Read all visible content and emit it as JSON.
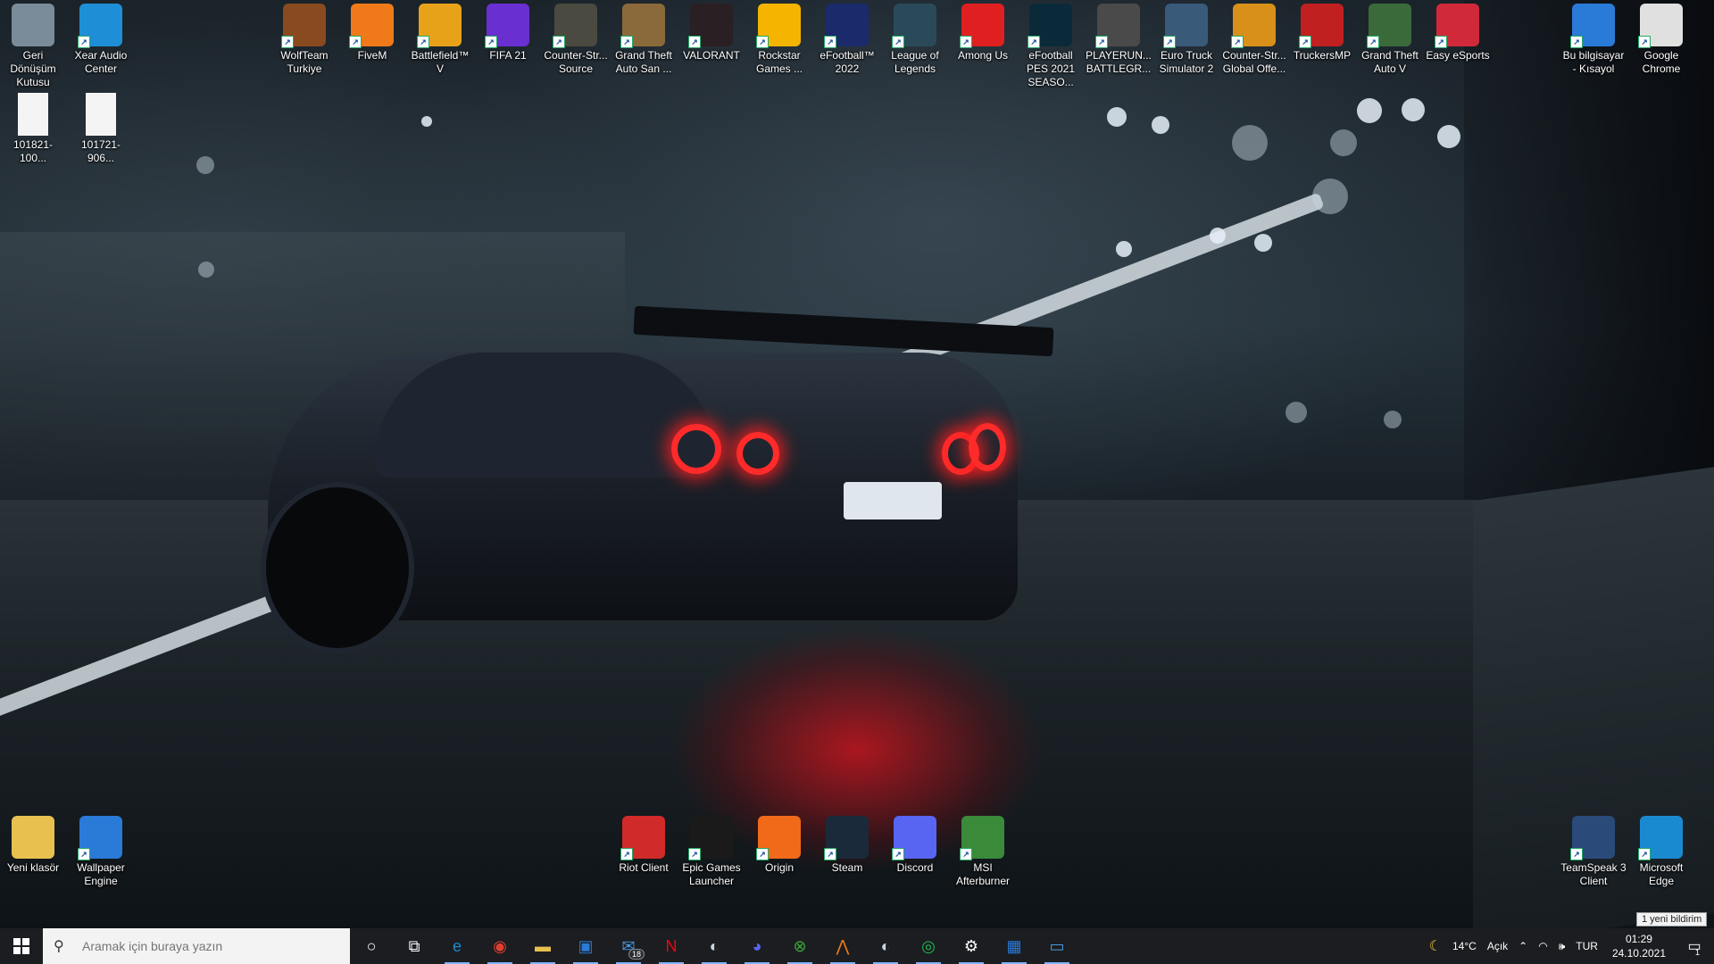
{
  "desktop": {
    "icons": [
      {
        "id": "recycle",
        "label": "Geri Dönüşüm Kutusu",
        "icon": "recycle-bin-icon",
        "color": "#7a8c99"
      },
      {
        "id": "xear",
        "label": "Xear Audio Center",
        "icon": "xear-audio-icon",
        "color": "#1e8fd6"
      },
      {
        "id": "wolfteam",
        "label": "WolfTeam Turkiye",
        "icon": "wolfteam-icon",
        "color": "#8a4a20"
      },
      {
        "id": "fivem",
        "label": "FiveM",
        "icon": "fivem-icon",
        "color": "#f07a1a"
      },
      {
        "id": "bf5",
        "label": "Battlefield™ V",
        "icon": "battlefield-icon",
        "color": "#e8a21a"
      },
      {
        "id": "fifa",
        "label": "FIFA 21",
        "icon": "fifa-icon",
        "color": "#6a2fd0"
      },
      {
        "id": "css",
        "label": "Counter-Str... Source",
        "icon": "cs-source-icon",
        "color": "#4a4a40"
      },
      {
        "id": "gtasa",
        "label": "Grand Theft Auto San ...",
        "icon": "gta-sa-icon",
        "color": "#8a6a3a"
      },
      {
        "id": "valorant",
        "label": "VALORANT",
        "icon": "valorant-icon",
        "color": "#2a1f22"
      },
      {
        "id": "rockstar",
        "label": "Rockstar Games ...",
        "icon": "rockstar-icon",
        "color": "#f4b400"
      },
      {
        "id": "efootball",
        "label": "eFootball™ 2022",
        "icon": "efootball-icon",
        "color": "#1a2a6a"
      },
      {
        "id": "lol",
        "label": "League of Legends",
        "icon": "lol-icon",
        "color": "#2a4a5a"
      },
      {
        "id": "amongus",
        "label": "Among Us",
        "icon": "among-us-icon",
        "color": "#e02020"
      },
      {
        "id": "pes",
        "label": "eFootball PES 2021 SEASO...",
        "icon": "pes-icon",
        "color": "#0a2a3a"
      },
      {
        "id": "pubg",
        "label": "PLAYERUN... BATTLEGR...",
        "icon": "pubg-icon",
        "color": "#4a4a4a"
      },
      {
        "id": "ets2",
        "label": "Euro Truck Simulator 2",
        "icon": "ets2-icon",
        "color": "#3a5a7a"
      },
      {
        "id": "csgo",
        "label": "Counter-Str... Global Offe...",
        "icon": "csgo-icon",
        "color": "#d8901a"
      },
      {
        "id": "truckersmp",
        "label": "TruckersMP",
        "icon": "truckersmp-icon",
        "color": "#c02020"
      },
      {
        "id": "gta5",
        "label": "Grand Theft Auto V",
        "icon": "gta5-icon",
        "color": "#3a6a3a"
      },
      {
        "id": "easy",
        "label": "Easy eSports",
        "icon": "easy-esports-icon",
        "color": "#d02a3a"
      },
      {
        "id": "thispc",
        "label": "Bu bilgisayar - Kısayol",
        "icon": "this-pc-icon",
        "color": "#2a7ad8"
      },
      {
        "id": "chrome",
        "label": "Google Chrome",
        "icon": "chrome-icon",
        "color": "#e0e0e0"
      },
      {
        "id": "file1",
        "label": "101821-100...",
        "icon": "file-icon",
        "color": "#f4f4f4"
      },
      {
        "id": "file2",
        "label": "101721-906...",
        "icon": "file-icon",
        "color": "#f4f4f4"
      },
      {
        "id": "folder",
        "label": "Yeni klasör",
        "icon": "folder-icon",
        "color": "#e8c050"
      },
      {
        "id": "wallpaper",
        "label": "Wallpaper Engine",
        "icon": "wallpaper-engine-icon",
        "color": "#2a7ad8"
      },
      {
        "id": "riot",
        "label": "Riot Client",
        "icon": "riot-icon",
        "color": "#d02a2a"
      },
      {
        "id": "epic",
        "label": "Epic Games Launcher",
        "icon": "epic-games-icon",
        "color": "#1a1a1a"
      },
      {
        "id": "origin",
        "label": "Origin",
        "icon": "origin-icon",
        "color": "#f06a1a"
      },
      {
        "id": "steam",
        "label": "Steam",
        "icon": "steam-icon",
        "color": "#1a2a3a"
      },
      {
        "id": "discord",
        "label": "Discord",
        "icon": "discord-icon",
        "color": "#5865f2"
      },
      {
        "id": "msi",
        "label": "MSI Afterburner",
        "icon": "msi-afterburner-icon",
        "color": "#3a8a3a"
      },
      {
        "id": "teamspeak",
        "label": "TeamSpeak 3 Client",
        "icon": "teamspeak-icon",
        "color": "#2a4a7a"
      },
      {
        "id": "edge",
        "label": "Microsoft Edge",
        "icon": "edge-icon",
        "color": "#1a8ad0"
      }
    ]
  },
  "taskbar": {
    "search_placeholder": "Aramak için buraya yazın",
    "apps": [
      {
        "name": "cortana",
        "glyph": "○"
      },
      {
        "name": "task-view",
        "glyph": "⧉"
      },
      {
        "name": "edge",
        "glyph": "e",
        "color": "#1a8ad0"
      },
      {
        "name": "chrome",
        "glyph": "◉",
        "color": "#e04030"
      },
      {
        "name": "file-explorer",
        "glyph": "▬",
        "color": "#e8c050"
      },
      {
        "name": "store",
        "glyph": "▣",
        "color": "#2a7ad8"
      },
      {
        "name": "mail",
        "glyph": "✉",
        "color": "#4a9ae0",
        "badge": "18"
      },
      {
        "name": "netflix",
        "glyph": "N",
        "color": "#e50914"
      },
      {
        "name": "steam",
        "glyph": "◐",
        "color": "#c7d5e0"
      },
      {
        "name": "discord",
        "glyph": "◕",
        "color": "#5865f2"
      },
      {
        "name": "xbox",
        "glyph": "⊗",
        "color": "#3aa83a"
      },
      {
        "name": "fivem",
        "glyph": "⋀",
        "color": "#f07a1a"
      },
      {
        "name": "steam-2",
        "glyph": "◐",
        "color": "#c7d5e0"
      },
      {
        "name": "spotify",
        "glyph": "◎",
        "color": "#1db954"
      },
      {
        "name": "settings",
        "glyph": "⚙",
        "color": "#ffffff"
      },
      {
        "name": "wallpaper-engine",
        "glyph": "▦",
        "color": "#2a7ad8"
      },
      {
        "name": "app-running",
        "glyph": "▭",
        "color": "#4a9ae0"
      }
    ]
  },
  "tray": {
    "weather": "14°C",
    "weather_status": "Açık",
    "language": "TUR",
    "time": "01:29",
    "date": "24.10.2021",
    "notification_text": "1 yeni bildirim",
    "notification_count": "1"
  }
}
